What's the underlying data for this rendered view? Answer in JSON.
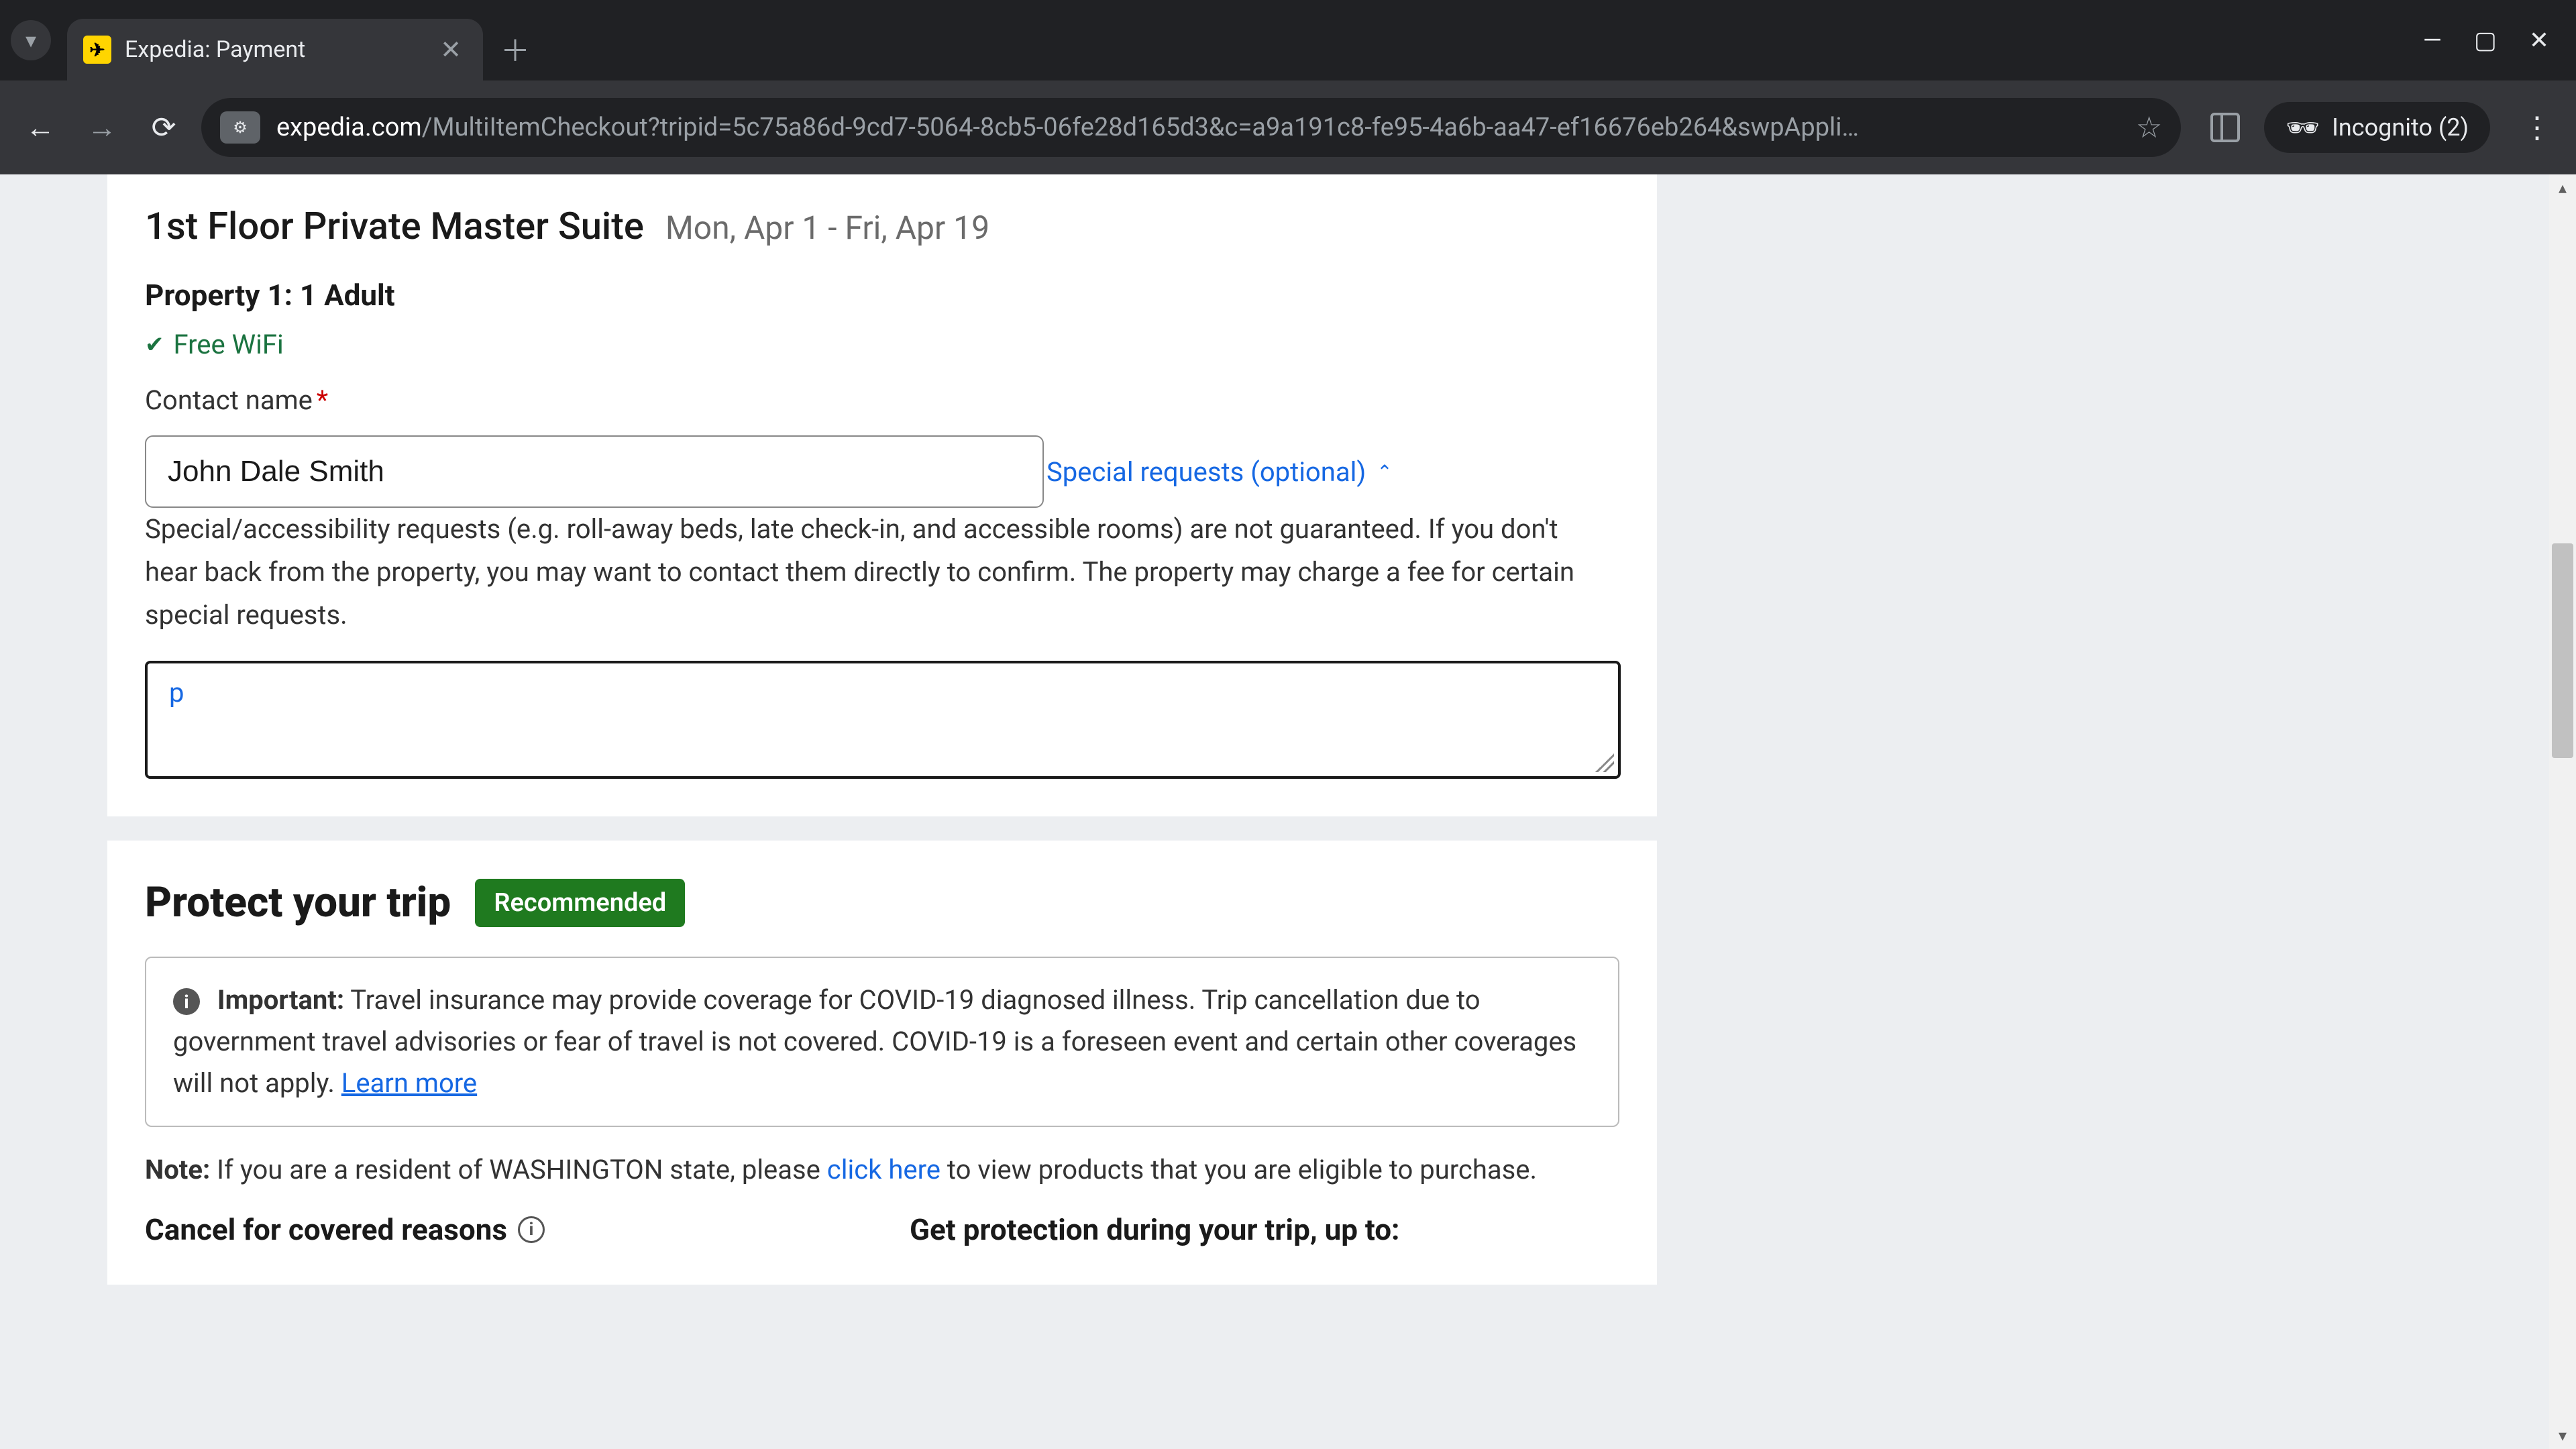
{
  "browser": {
    "tab_title": "Expedia: Payment",
    "url_domain": "expedia.com",
    "url_path": "/MultiItemCheckout?tripid=5c75a86d-9cd7-5064-8cb5-06fe28d165d3&c=a9a191c8-fe95-4a6b-aa47-ef16676eb264&swpAppli…",
    "incognito_label": "Incognito (2)"
  },
  "booking": {
    "room_title": "1st Floor Private Master Suite",
    "date_range": "Mon, Apr 1 - Fri, Apr 19",
    "guest_summary": "Property 1: 1 Adult",
    "amenity": "Free WiFi",
    "contact_label": "Contact name",
    "contact_value": "John Dale Smith",
    "special_requests_link": "Special requests (optional)",
    "special_requests_help": "Special/accessibility requests (e.g. roll-away beds, late check-in, and accessible rooms) are not guaranteed. If you don't hear back from the property, you may want to contact them directly to confirm. The property may charge a fee for certain special requests.",
    "special_requests_value": "p"
  },
  "protect": {
    "title": "Protect your trip",
    "badge": "Recommended",
    "important_label": "Important:",
    "important_text": " Travel insurance may provide coverage for COVID-19 diagnosed illness. Trip cancellation due to government travel advisories or fear of travel is not covered. COVID-19 is a foreseen event and certain other coverages will not apply. ",
    "learn_more": "Learn more",
    "note_label": "Note:",
    "note_text_before": " If you are a resident of WASHINGTON state, please ",
    "note_link": "click here",
    "note_text_after": " to view products that you are eligible to purchase.",
    "col1_heading": "Cancel for covered reasons",
    "col2_heading": "Get protection during your trip, up to:"
  }
}
